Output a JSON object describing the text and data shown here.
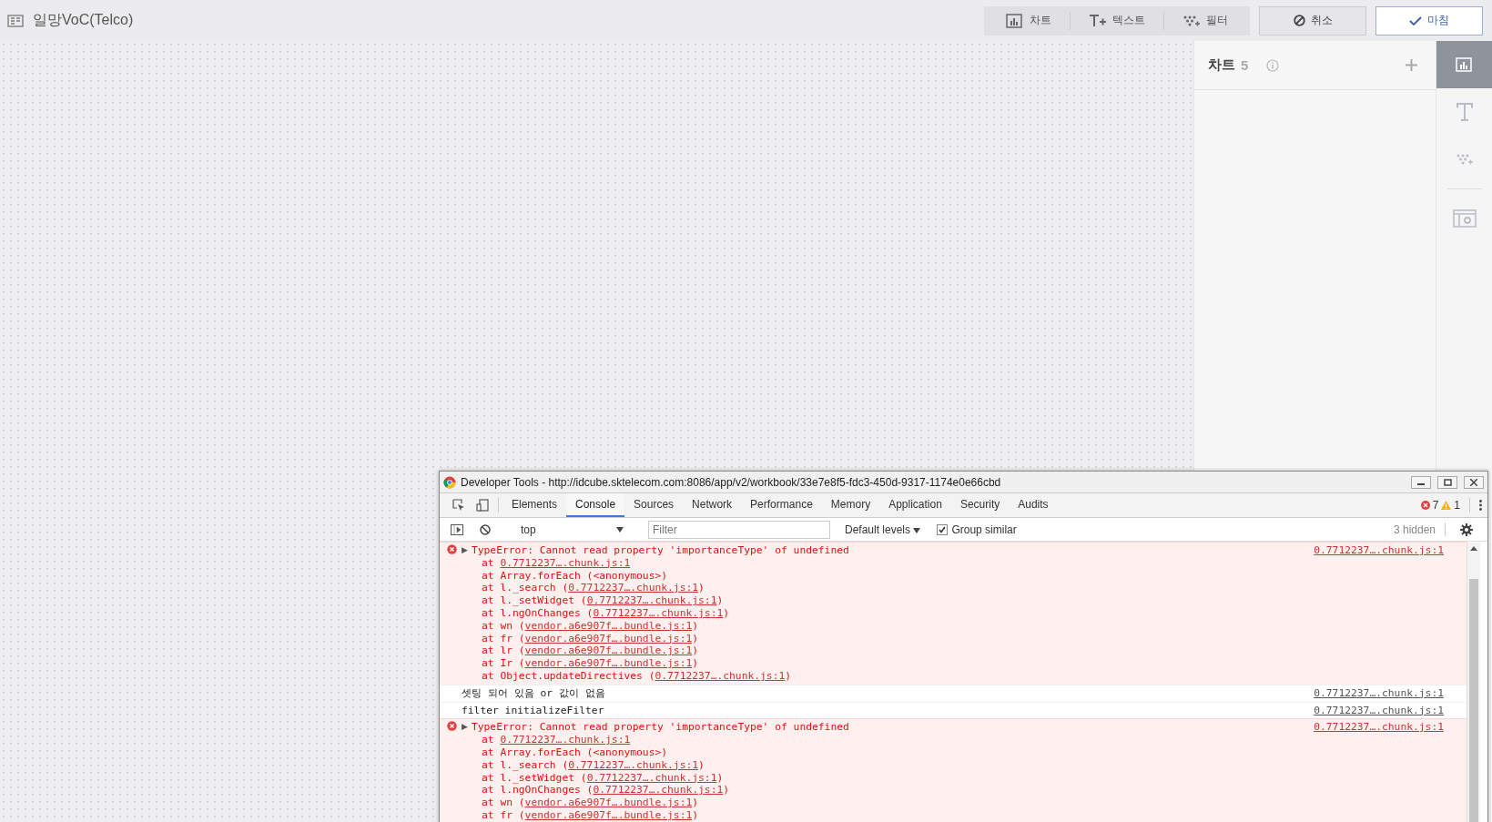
{
  "header": {
    "title": "일망VoC(Telco)",
    "tools": [
      {
        "kind": "chart",
        "label": "차트"
      },
      {
        "kind": "text",
        "label": "텍스트"
      },
      {
        "kind": "filter",
        "label": "필터"
      }
    ],
    "actions": [
      {
        "kind": "cancel",
        "label": "취소",
        "primary": false
      },
      {
        "kind": "done",
        "label": "마침",
        "primary": true
      }
    ]
  },
  "panel": {
    "title": "차트",
    "count": "5"
  },
  "rail": [
    {
      "kind": "chart",
      "selected": true
    },
    {
      "kind": "text",
      "selected": false
    },
    {
      "kind": "filter",
      "selected": false
    },
    {
      "kind": "settings",
      "selected": false
    }
  ],
  "devtools": {
    "title": "Developer Tools - http://idcube.sktelecom.com:8086/app/v2/workbook/33e7e8f5-fdc3-450d-9317-1174e0e66cbd",
    "tabs": [
      {
        "label": "Elements",
        "selected": false
      },
      {
        "label": "Console",
        "selected": true
      },
      {
        "label": "Sources",
        "selected": false
      },
      {
        "label": "Network",
        "selected": false
      },
      {
        "label": "Performance",
        "selected": false
      },
      {
        "label": "Memory",
        "selected": false
      },
      {
        "label": "Application",
        "selected": false
      },
      {
        "label": "Security",
        "selected": false
      },
      {
        "label": "Audits",
        "selected": false
      }
    ],
    "error_count": "7",
    "warning_count": "1",
    "context": "top",
    "filter_placeholder": "Filter",
    "levels": "Default levels",
    "group_similar": {
      "label": "Group similar",
      "checked": true
    },
    "hidden": "3 hidden",
    "messages": [
      {
        "kind": "error",
        "toggle": "▶",
        "text": "TypeError: Cannot read property 'importanceType' of undefined",
        "source": "0.7712237….chunk.js:1",
        "stack": [
          {
            "text": "at ",
            "link": "0.7712237….chunk.js:1"
          },
          {
            "text": "at Array.forEach (<anonymous>)"
          },
          {
            "text": "at l._search (",
            "link": "0.7712237….chunk.js:1",
            "end": ")"
          },
          {
            "text": "at l._setWidget (",
            "link": "0.7712237….chunk.js:1",
            "end": ")"
          },
          {
            "text": "at l.ngOnChanges (",
            "link": "0.7712237….chunk.js:1",
            "end": ")"
          },
          {
            "text": "at wn (",
            "link": "vendor.a6e907f….bundle.js:1",
            "end": ")"
          },
          {
            "text": "at fr (",
            "link": "vendor.a6e907f….bundle.js:1",
            "end": ")"
          },
          {
            "text": "at lr (",
            "link": "vendor.a6e907f….bundle.js:1",
            "end": ")"
          },
          {
            "text": "at Ir (",
            "link": "vendor.a6e907f….bundle.js:1",
            "end": ")"
          },
          {
            "text": "at Object.updateDirectives (",
            "link": "0.7712237….chunk.js:1",
            "end": ")"
          }
        ]
      },
      {
        "kind": "log",
        "text": "셋팅 되어 있음 or 값이 없음",
        "source": "0.7712237….chunk.js:1"
      },
      {
        "kind": "log",
        "text": "filter initializeFilter",
        "source": "0.7712237….chunk.js:1"
      },
      {
        "kind": "error",
        "toggle": "▶",
        "text": "TypeError: Cannot read property 'importanceType' of undefined",
        "source": "0.7712237….chunk.js:1",
        "stack": [
          {
            "text": "at ",
            "link": "0.7712237….chunk.js:1"
          },
          {
            "text": "at Array.forEach (<anonymous>)"
          },
          {
            "text": "at l._search (",
            "link": "0.7712237….chunk.js:1",
            "end": ")"
          },
          {
            "text": "at l._setWidget (",
            "link": "0.7712237….chunk.js:1",
            "end": ")"
          },
          {
            "text": "at l.ngOnChanges (",
            "link": "0.7712237….chunk.js:1",
            "end": ")"
          },
          {
            "text": "at wn (",
            "link": "vendor.a6e907f….bundle.js:1",
            "end": ")"
          },
          {
            "text": "at fr (",
            "link": "vendor.a6e907f….bundle.js:1",
            "end": ")"
          }
        ]
      }
    ]
  }
}
